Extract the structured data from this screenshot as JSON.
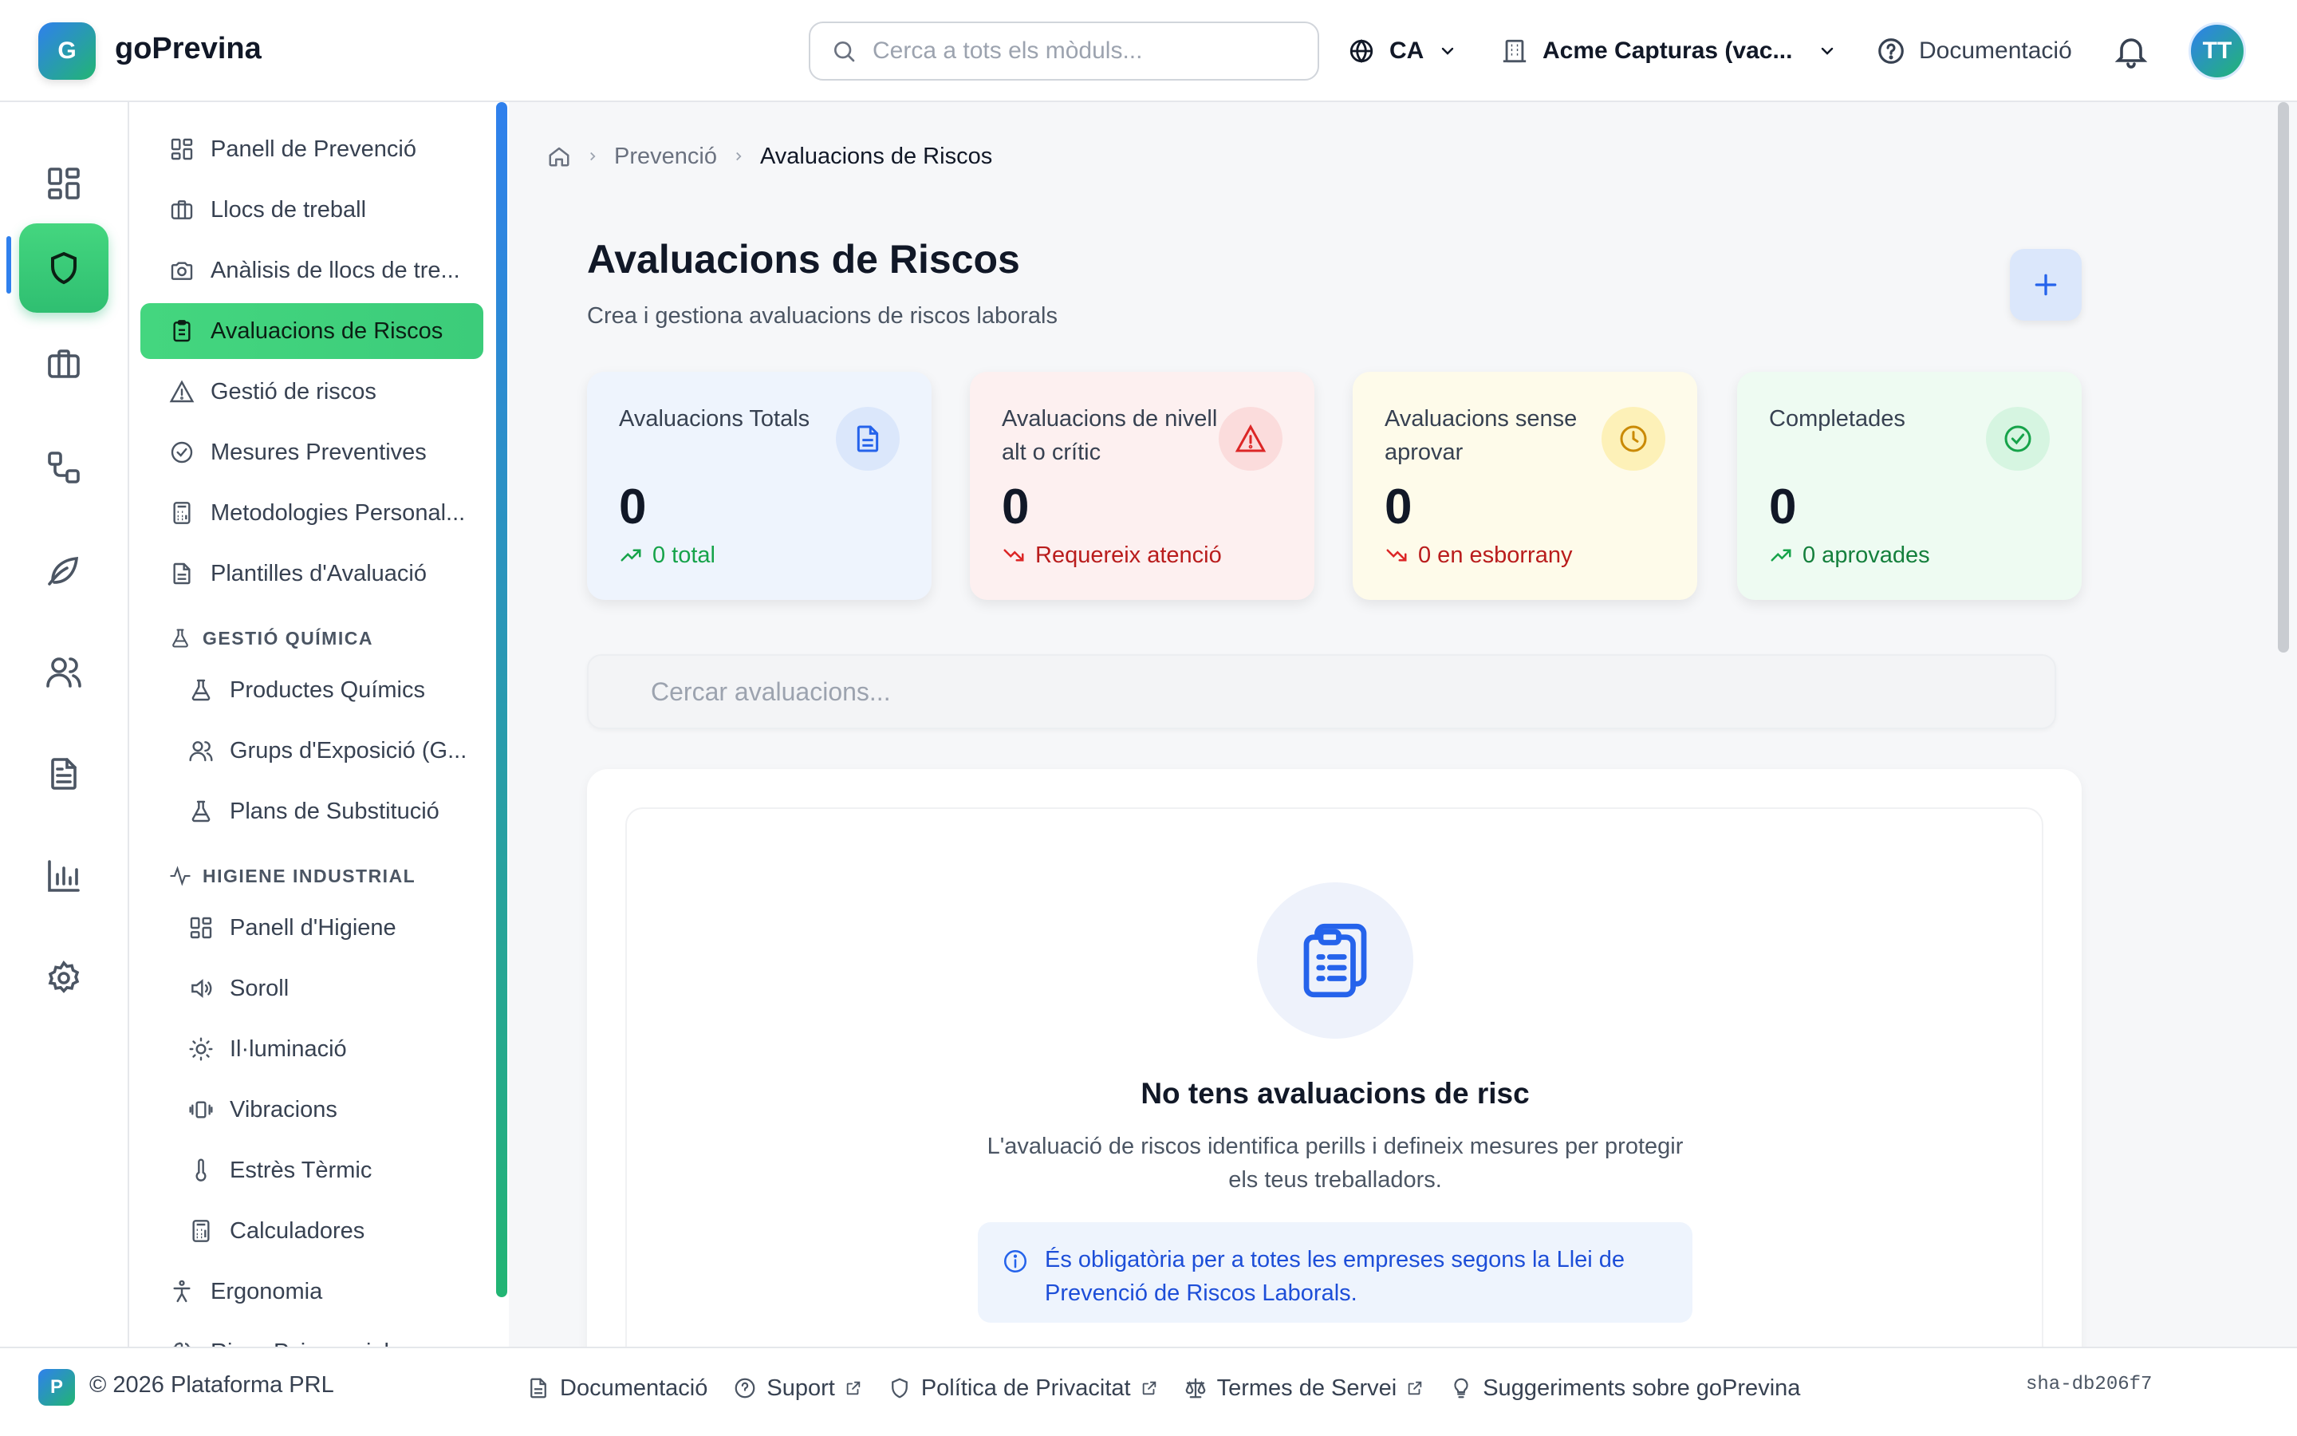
{
  "app": {
    "logo_letter": "G",
    "name": "goPrevina"
  },
  "topbar": {
    "search_placeholder": "Cerca a tots els mòduls...",
    "language": "CA",
    "company": "Acme Capturas (vac...",
    "docs": "Documentació",
    "avatar_initials": "TT"
  },
  "rail": {
    "items": [
      "dashboard-icon",
      "shield-icon",
      "briefcase-icon",
      "workflow-icon",
      "leaf-icon",
      "users-icon",
      "document-icon",
      "chart-icon",
      "settings-icon"
    ],
    "active": "shield-icon"
  },
  "sidebar": {
    "items": [
      {
        "label": "Panell de Prevenció",
        "icon": "grid-icon"
      },
      {
        "label": "Llocs de treball",
        "icon": "briefcase-icon"
      },
      {
        "label": "Anàlisis de llocs de tre...",
        "icon": "camera-icon"
      },
      {
        "label": "Avaluacions de Riscos",
        "icon": "clipboard-icon",
        "active": true
      },
      {
        "label": "Gestió de riscos",
        "icon": "warning-icon"
      },
      {
        "label": "Mesures Preventives",
        "icon": "check-circle-icon"
      },
      {
        "label": "Metodologies Personal...",
        "icon": "calculator-icon"
      },
      {
        "label": "Plantilles d'Avaluació",
        "icon": "file-icon"
      }
    ],
    "section_chem": "GESTIÓ QUÍMICA",
    "chem_items": [
      {
        "label": "Productes Químics",
        "icon": "flask-icon"
      },
      {
        "label": "Grups d'Exposició (G...",
        "icon": "users-icon"
      },
      {
        "label": "Plans de Substitució",
        "icon": "flask-icon"
      }
    ],
    "section_hyg": "HIGIENE INDUSTRIAL",
    "hyg_items": [
      {
        "label": "Panell d'Higiene",
        "icon": "grid-icon"
      },
      {
        "label": "Soroll",
        "icon": "speaker-icon"
      },
      {
        "label": "Il·luminació",
        "icon": "sun-icon"
      },
      {
        "label": "Vibracions",
        "icon": "vibration-icon"
      },
      {
        "label": "Estrès Tèrmic",
        "icon": "thermometer-icon"
      },
      {
        "label": "Calculadores",
        "icon": "calculator-icon"
      }
    ],
    "ergonomia": "Ergonomia",
    "cut_item": "Riscs Psicosocials"
  },
  "breadcrumb": {
    "parent": "Prevenció",
    "current": "Avaluacions de Riscos"
  },
  "page": {
    "title": "Avaluacions de Riscos",
    "subtitle": "Crea i gestiona avaluacions de riscos laborals"
  },
  "stats": [
    {
      "label": "Avaluacions Totals",
      "value": "0",
      "foot": "0 total",
      "trend": "up",
      "color": "#2563eb",
      "bg": "#eef4fd",
      "icon_bg": "#dbe7fb",
      "icon": "file-icon"
    },
    {
      "label": "Avaluacions de nivell alt o crític",
      "value": "0",
      "foot": "Requereix atenció",
      "trend": "down",
      "color": "#dc2626",
      "bg": "#fdf0f0",
      "icon_bg": "#fbdcdc",
      "icon": "alert-icon"
    },
    {
      "label": "Avaluacions sense aprovar",
      "value": "0",
      "foot": "0 en esborrany",
      "trend": "down",
      "color": "#ca8a04",
      "bg": "#fefbea",
      "icon_bg": "#fdf1b8",
      "icon": "clock-icon"
    },
    {
      "label": "Completades",
      "value": "0",
      "foot": "0 aprovades",
      "trend": "up",
      "color": "#16a34a",
      "bg": "#eefbf2",
      "icon_bg": "#d6f5e1",
      "icon": "check-circle-icon"
    }
  ],
  "search": {
    "placeholder": "Cercar avaluacions..."
  },
  "empty": {
    "title": "No tens avaluacions de risc",
    "text": "L'avaluació de riscos identifica perills i defineix mesures per protegir els teus treballadors.",
    "info": "És obligatòria per a totes les empreses segons la Llei de Prevenció de Riscos Laborals."
  },
  "footer": {
    "logo_letter": "P",
    "copyright": "© 2026 Plataforma PRL",
    "links": [
      "Documentació",
      "Suport",
      "Política de Privacitat",
      "Termes de Servei",
      "Suggeriments sobre goPrevina"
    ],
    "sha": "sha-db206f7"
  },
  "colors": {
    "accent_green": "#3ccc7a",
    "accent_blue": "#2f80ed"
  }
}
